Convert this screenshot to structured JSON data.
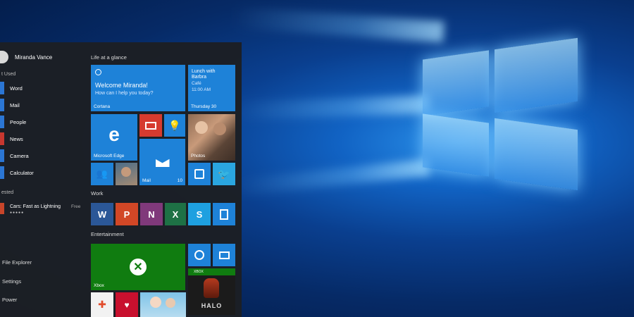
{
  "user": {
    "name": "Miranda Vance"
  },
  "sections": {
    "most_used": "t Used",
    "suggested": "ested"
  },
  "apps": [
    {
      "label": "Word"
    },
    {
      "label": "Mail"
    },
    {
      "label": "People"
    },
    {
      "label": "News"
    },
    {
      "label": "Camera"
    },
    {
      "label": "Calculator"
    }
  ],
  "suggested_app": {
    "name": "Cars: Fast as Lightning",
    "price": "Free",
    "rating": "●●●●●"
  },
  "system": [
    {
      "label": "File Explorer"
    },
    {
      "label": "Settings"
    },
    {
      "label": "Power"
    }
  ],
  "groups": {
    "life": "Life at a glance",
    "work": "Work",
    "entertainment": "Entertainment"
  },
  "cortana": {
    "line1": "Welcome Miranda!",
    "line2": "How can I help you today?",
    "label": "Cortana"
  },
  "calendar": {
    "line1": "Lunch with",
    "line2": "Barbra",
    "line3": "Café",
    "line4": "11:00 AM",
    "day": "Thursday 30"
  },
  "tiles": {
    "edge": "Microsoft Edge",
    "mail": "Mail",
    "mail_count": "10",
    "photos": "Photos",
    "xbox": "Xbox",
    "xbox_badge": "XBOX",
    "halo": "HALO"
  },
  "colors": {
    "tile_blue": "#1e82d8",
    "xbox_green": "#107c10",
    "menu_bg": "#1c1f24"
  }
}
